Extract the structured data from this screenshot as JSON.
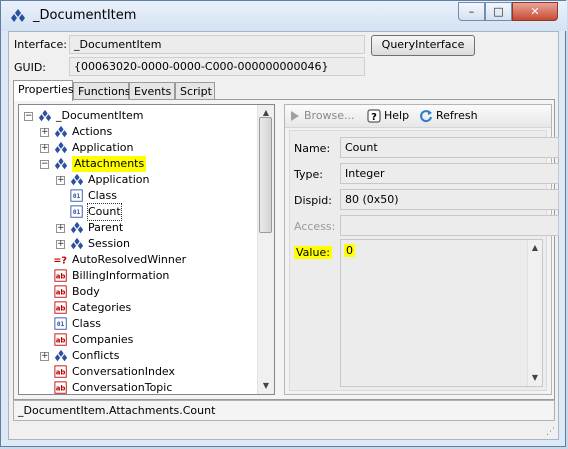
{
  "window": {
    "title": "_DocumentItem",
    "controls": {
      "minimize": "–",
      "maximize": "□",
      "close": "✕"
    }
  },
  "interface": {
    "interface_label": "Interface:",
    "interface_value": "_DocumentItem",
    "guid_label": "GUID:",
    "guid_value": "{00063020-0000-0000-C000-000000000046}",
    "query_button": "QueryInterface"
  },
  "tabs": [
    {
      "label": "Properties",
      "active": true
    },
    {
      "label": "Functions",
      "active": false
    },
    {
      "label": "Events",
      "active": false
    },
    {
      "label": "Script",
      "active": false
    }
  ],
  "tree": {
    "root": {
      "label": "_DocumentItem",
      "icon": "interface-icon",
      "expander": "−"
    },
    "items": [
      {
        "label": "Actions",
        "icon": "interface-icon",
        "expander": "+"
      },
      {
        "label": "Application",
        "icon": "interface-icon",
        "expander": "+"
      },
      {
        "label": "Attachments",
        "icon": "interface-icon",
        "expander": "−",
        "highlighted": true
      },
      {
        "label": "Application",
        "icon": "interface-icon",
        "expander": "+"
      },
      {
        "label": "Class",
        "icon": "enum-icon",
        "expander": ""
      },
      {
        "label": "Count",
        "icon": "enum-icon",
        "expander": "",
        "selected": true
      },
      {
        "label": "Parent",
        "icon": "interface-icon",
        "expander": "+"
      },
      {
        "label": "Session",
        "icon": "interface-icon",
        "expander": "+"
      },
      {
        "label": "AutoResolvedWinner",
        "icon": "bool-icon",
        "expander": ""
      },
      {
        "label": "BillingInformation",
        "icon": "string-icon",
        "expander": ""
      },
      {
        "label": "Body",
        "icon": "string-icon",
        "expander": ""
      },
      {
        "label": "Categories",
        "icon": "string-icon",
        "expander": ""
      },
      {
        "label": "Class",
        "icon": "enum-icon",
        "expander": ""
      },
      {
        "label": "Companies",
        "icon": "string-icon",
        "expander": ""
      },
      {
        "label": "Conflicts",
        "icon": "interface-icon",
        "expander": "+"
      },
      {
        "label": "ConversationIndex",
        "icon": "string-icon",
        "expander": ""
      },
      {
        "label": "ConversationTopic",
        "icon": "string-icon",
        "expander": ""
      }
    ]
  },
  "toolbar": {
    "browse": "Browse...",
    "help": "Help",
    "refresh": "Refresh"
  },
  "properties": {
    "name_label": "Name:",
    "name_value": "Count",
    "type_label": "Type:",
    "type_value": "Integer",
    "dispid_label": "Dispid:",
    "dispid_value": "80  (0x50)",
    "access_label": "Access:",
    "access_value": "",
    "value_label": "Value:",
    "value_value": "0"
  },
  "status": {
    "path": "_DocumentItem.Attachments.Count"
  },
  "colors": {
    "highlight": "#ffff00",
    "interface_icon": "#2b4fa0",
    "string_icon": "#c00000"
  }
}
